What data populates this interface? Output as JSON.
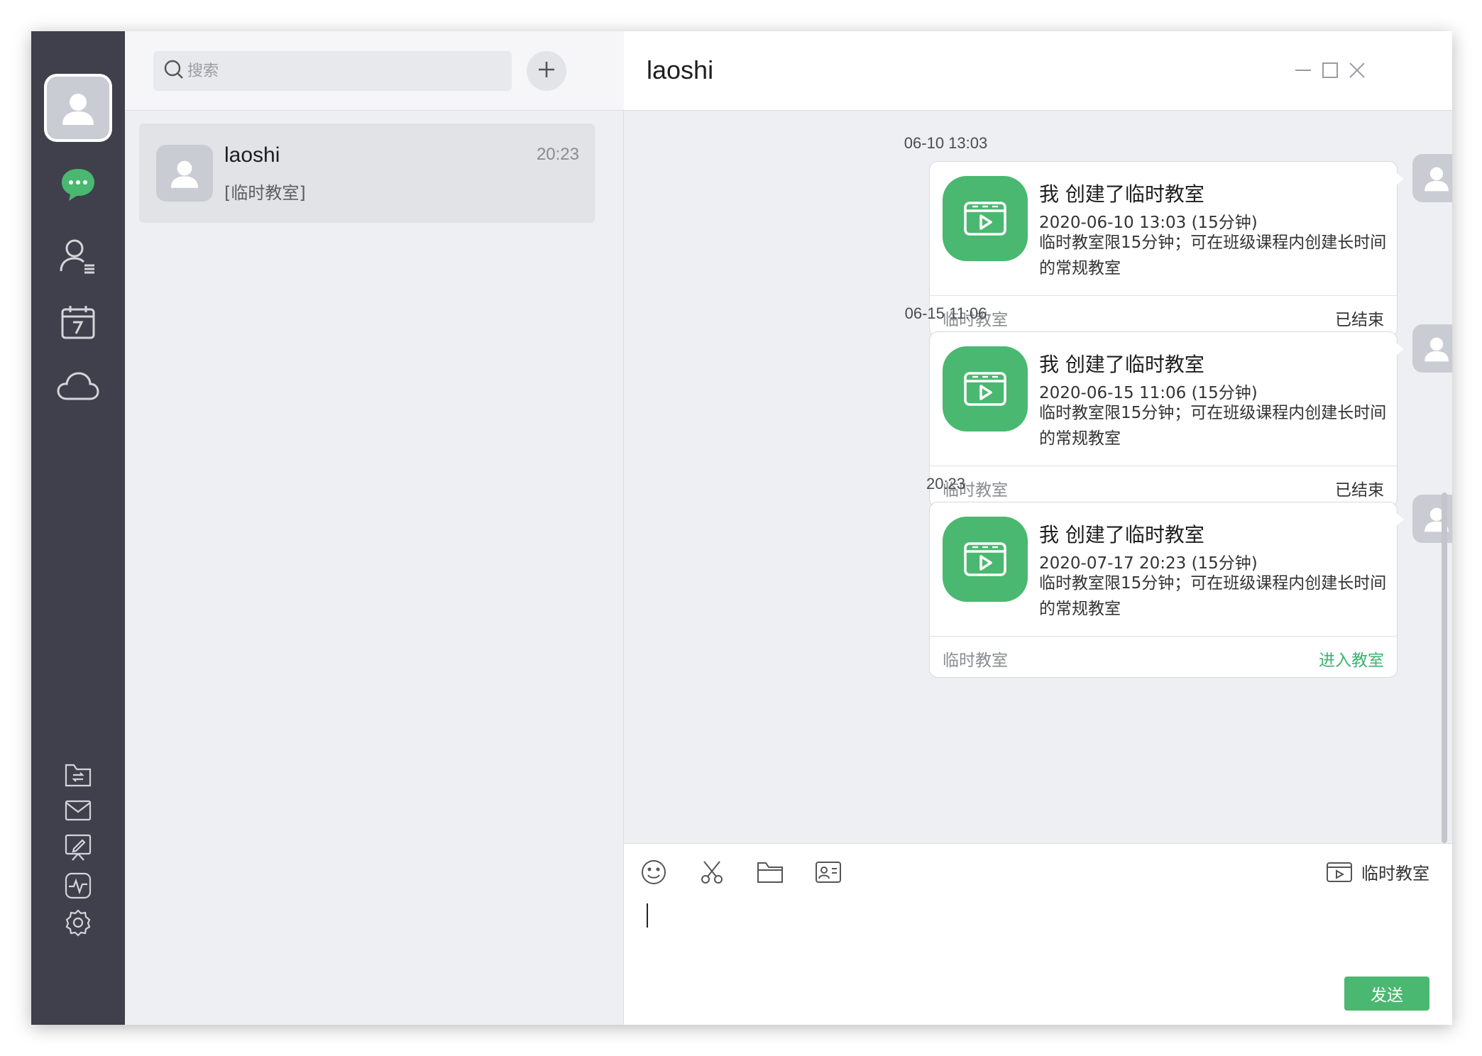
{
  "search": {
    "placeholder": "搜索"
  },
  "conversation": {
    "name": "laoshi",
    "time": "20:23",
    "preview": "[临时教室]"
  },
  "chat": {
    "title": "laoshi"
  },
  "messages": [
    {
      "timestamp": "06-10 13:03",
      "title": "我 创建了临时教室",
      "date": "2020-06-10 13:03  (15分钟)",
      "desc": "临时教室限15分钟；可在班级课程内创建长时间的常规教室",
      "footer_left": "临时教室",
      "footer_right": "已结束"
    },
    {
      "timestamp": "06-15 11:06",
      "title": "我 创建了临时教室",
      "date": "2020-06-15 11:06  (15分钟)",
      "desc": "临时教室限15分钟；可在班级课程内创建长时间的常规教室",
      "footer_left": "临时教室",
      "footer_right": "已结束"
    },
    {
      "timestamp": "20:23",
      "title": "我 创建了临时教室",
      "date": "2020-07-17 20:23  (15分钟)",
      "desc": "临时教室限15分钟；可在班级课程内创建长时间的常规教室",
      "footer_left": "临时教室",
      "footer_right": "进入教室"
    }
  ],
  "composer": {
    "temp_class_label": "临时教室",
    "send_label": "发送"
  },
  "icons": {
    "rail": [
      "user-avatar-icon",
      "chat-icon",
      "contacts-icon",
      "calendar-icon",
      "cloud-icon",
      "file-transfer-icon",
      "mail-icon",
      "whiteboard-icon",
      "activity-icon",
      "settings-icon"
    ],
    "toolbar": [
      "emoji-icon",
      "scissors-icon",
      "folder-icon",
      "contact-card-icon",
      "temp-class-icon"
    ]
  },
  "colors": {
    "accent": "#4ab870",
    "rail_bg": "#3f404b",
    "panel_bg": "#eeeff3"
  }
}
